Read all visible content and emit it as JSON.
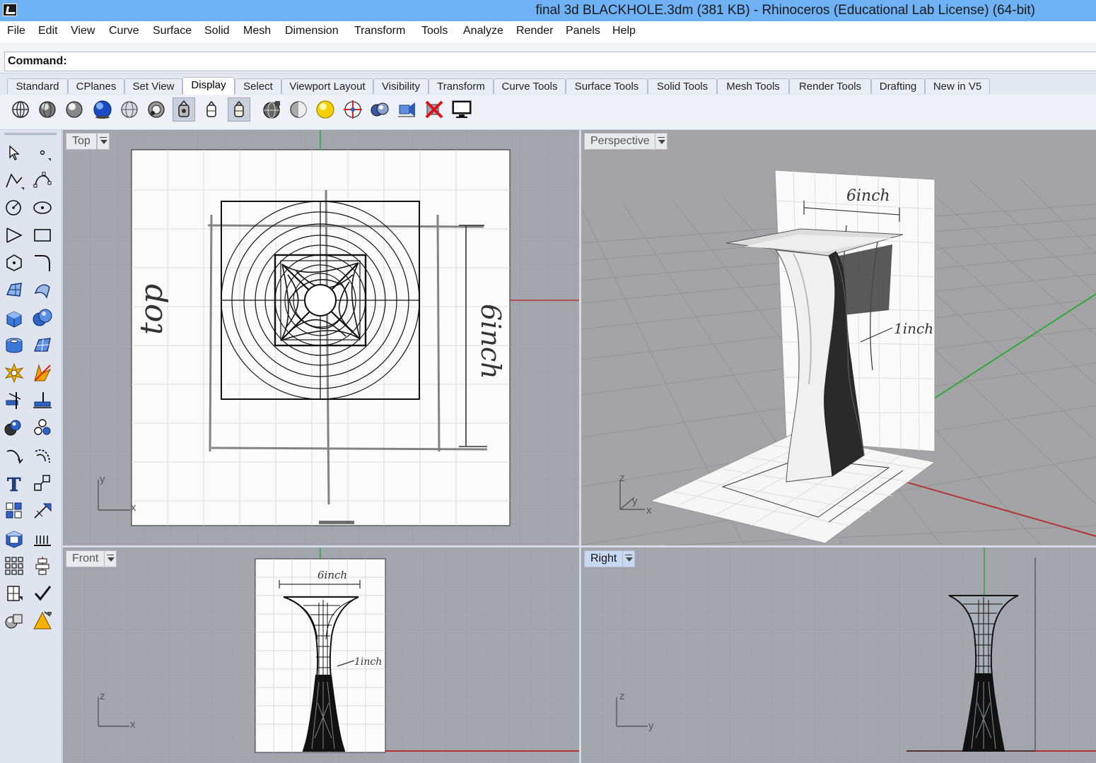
{
  "window": {
    "title": "final 3d  BLACKHOLE.3dm (381 KB) - Rhinoceros (Educational Lab License) (64-bit)"
  },
  "menu": [
    "File",
    "Edit",
    "View",
    "Curve",
    "Surface",
    "Solid",
    "Mesh",
    "Dimension",
    "Transform",
    "Tools",
    "Analyze",
    "Render",
    "Panels",
    "Help"
  ],
  "command": {
    "label": "Command:",
    "value": ""
  },
  "tabs": [
    "Standard",
    "CPlanes",
    "Set View",
    "Display",
    "Select",
    "Viewport Layout",
    "Visibility",
    "Transform",
    "Curve Tools",
    "Surface Tools",
    "Solid Tools",
    "Mesh Tools",
    "Render Tools",
    "Drafting",
    "New in V5"
  ],
  "active_tab": "Display",
  "display_toolbar_icons": [
    "wireframe-icon",
    "shaded-icon",
    "rendered-icon",
    "ghosted-icon",
    "xray-icon",
    "technical-icon",
    "pen-icon",
    "artistic-icon",
    "custom-display-icon",
    "display-mode-icon",
    "shade-selected-icon",
    "sun-light-icon",
    "cplane-grid-icon",
    "clipping-plane-icon",
    "toggle-visibility-icon",
    "close-display-icon",
    "monitor-icon"
  ],
  "left_tools": [
    [
      "select-arrow-icon",
      "point-icon"
    ],
    [
      "polyline-icon",
      "curve-control-points-icon"
    ],
    [
      "circle-icon",
      "ellipse-icon"
    ],
    [
      "arc-icon",
      "rectangle-icon"
    ],
    [
      "polygon-icon",
      "fillet-curve-icon"
    ],
    [
      "surface-corner-points-icon",
      "surface-edge-icon"
    ],
    [
      "box-solid-icon",
      "solid-union-icon"
    ],
    [
      "cylinder-icon",
      "mesh-plane-icon"
    ],
    [
      "explode-icon",
      "trim-icon"
    ],
    [
      "split-icon",
      "extend-icon"
    ],
    [
      "group-icon",
      "array-points-icon"
    ],
    [
      "offset-curve-icon",
      "blend-curve-icon"
    ],
    [
      "text-icon",
      "scale-icon"
    ],
    [
      "grid-snap-icon",
      "dimension-icon"
    ],
    [
      "block-icon",
      "hatch-icon"
    ],
    [
      "array-icon",
      "align-icon"
    ],
    [
      "analyze-icon",
      "check-icon"
    ],
    [
      "render-objects-icon",
      "light-icon"
    ]
  ],
  "viewports": {
    "top": {
      "label": "Top",
      "axis_y": "y",
      "axis_x": "x"
    },
    "perspective": {
      "label": "Perspective",
      "axis_z": "z",
      "axis_y": "y",
      "axis_x": "x"
    },
    "front": {
      "label": "Front",
      "axis_z": "z",
      "axis_x": "x"
    },
    "right": {
      "label": "Right",
      "axis_z": "z",
      "axis_y": "y"
    }
  },
  "sketch_annotations": {
    "top": "top",
    "six_inch": "6inch",
    "one_inch": "1inch"
  },
  "colors": {
    "titlebar": "#6eb1f4",
    "viewport_bg": "#a3a7ad",
    "perspective_bg": "#a4a4a6",
    "grid": "#999da4",
    "axis_x": "#b43232",
    "axis_y": "#2fa83a"
  }
}
